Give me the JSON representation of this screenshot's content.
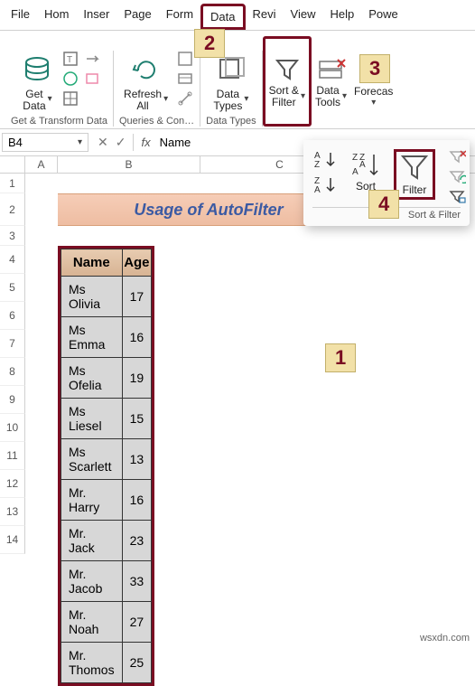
{
  "menu": {
    "items": [
      "File",
      "Hom",
      "Inser",
      "Page",
      "Form",
      "Data",
      "Revi",
      "View",
      "Help",
      "Powe"
    ]
  },
  "ribbon": {
    "get_data": "Get\nData",
    "refresh_all": "Refresh\nAll",
    "data_types": "Data\nTypes",
    "sort_filter": "Sort &\nFilter",
    "data_tools": "Data\nTools",
    "forecast": "Forecas",
    "group_names": {
      "a": "Get & Transform Data",
      "b": "Queries & Con…",
      "c": "Data Types"
    }
  },
  "callouts": {
    "c1": "1",
    "c2": "2",
    "c3": "3",
    "c4": "4"
  },
  "drop": {
    "sort": "Sort",
    "filter": "Filter",
    "group": "Sort & Filter"
  },
  "namebox": "B4",
  "fx_label": "fx",
  "fx_value": "Name",
  "cols": [
    "A",
    "B",
    "C"
  ],
  "rows": [
    "1",
    "2",
    "3",
    "4",
    "5",
    "6",
    "7",
    "8",
    "9",
    "10",
    "11",
    "12",
    "13",
    "14"
  ],
  "title": "Usage of AutoFilter",
  "table": {
    "headers": [
      "Name",
      "Age"
    ],
    "rows": [
      [
        "Ms Olivia",
        "17"
      ],
      [
        "Ms Emma",
        "16"
      ],
      [
        "Ms Ofelia",
        "19"
      ],
      [
        "Ms Liesel",
        "15"
      ],
      [
        "Ms Scarlett",
        "13"
      ],
      [
        "Mr. Harry",
        "16"
      ],
      [
        "Mr. Jack",
        "23"
      ],
      [
        "Mr. Jacob",
        "33"
      ],
      [
        "Mr. Noah",
        "27"
      ],
      [
        "Mr. Thomos",
        "25"
      ]
    ]
  },
  "site": "wsxdn.com"
}
